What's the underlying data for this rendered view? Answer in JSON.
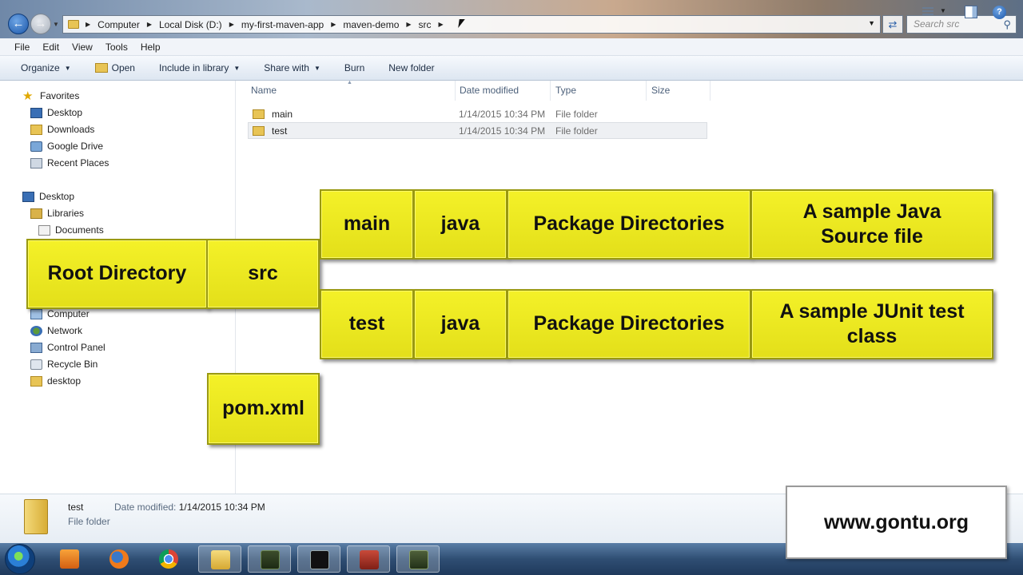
{
  "window": {
    "breadcrumbs": [
      "Computer",
      "Local Disk (D:)",
      "my-first-maven-app",
      "maven-demo",
      "src"
    ],
    "search_placeholder": "Search src"
  },
  "menu": [
    "File",
    "Edit",
    "View",
    "Tools",
    "Help"
  ],
  "toolbar": {
    "organize": "Organize",
    "open": "Open",
    "include": "Include in library",
    "share": "Share with",
    "burn": "Burn",
    "new_folder": "New folder"
  },
  "nav": {
    "favorites": "Favorites",
    "desktop_fav": "Desktop",
    "downloads": "Downloads",
    "google_drive": "Google Drive",
    "recent_places": "Recent Places",
    "desktop": "Desktop",
    "libraries": "Libraries",
    "documents": "Documents",
    "computer": "Computer",
    "network": "Network",
    "control_panel": "Control Panel",
    "recycle_bin": "Recycle Bin",
    "desktop_folder": "desktop"
  },
  "columns": {
    "name": "Name",
    "date": "Date modified",
    "type": "Type",
    "size": "Size"
  },
  "files": [
    {
      "name": "main",
      "date": "1/14/2015 10:34 PM",
      "type": "File folder"
    },
    {
      "name": "test",
      "date": "1/14/2015 10:34 PM",
      "type": "File folder"
    }
  ],
  "details": {
    "name": "test",
    "modified_label": "Date modified:",
    "modified_value": "1/14/2015 10:34 PM",
    "type": "File folder"
  },
  "overlay": {
    "root": "Root Directory",
    "src": "src",
    "pom": "pom.xml",
    "main": "main",
    "java1": "java",
    "pkg1": "Package Directories",
    "sample_java": "A sample Java Source file",
    "test": "test",
    "java2": "java",
    "pkg2": "Package Directories",
    "sample_junit": "A sample JUnit test class",
    "website": "www.gontu.org"
  },
  "colors": {
    "overlay_yellow": "#f1ee24",
    "selection": "#eef0f3"
  }
}
